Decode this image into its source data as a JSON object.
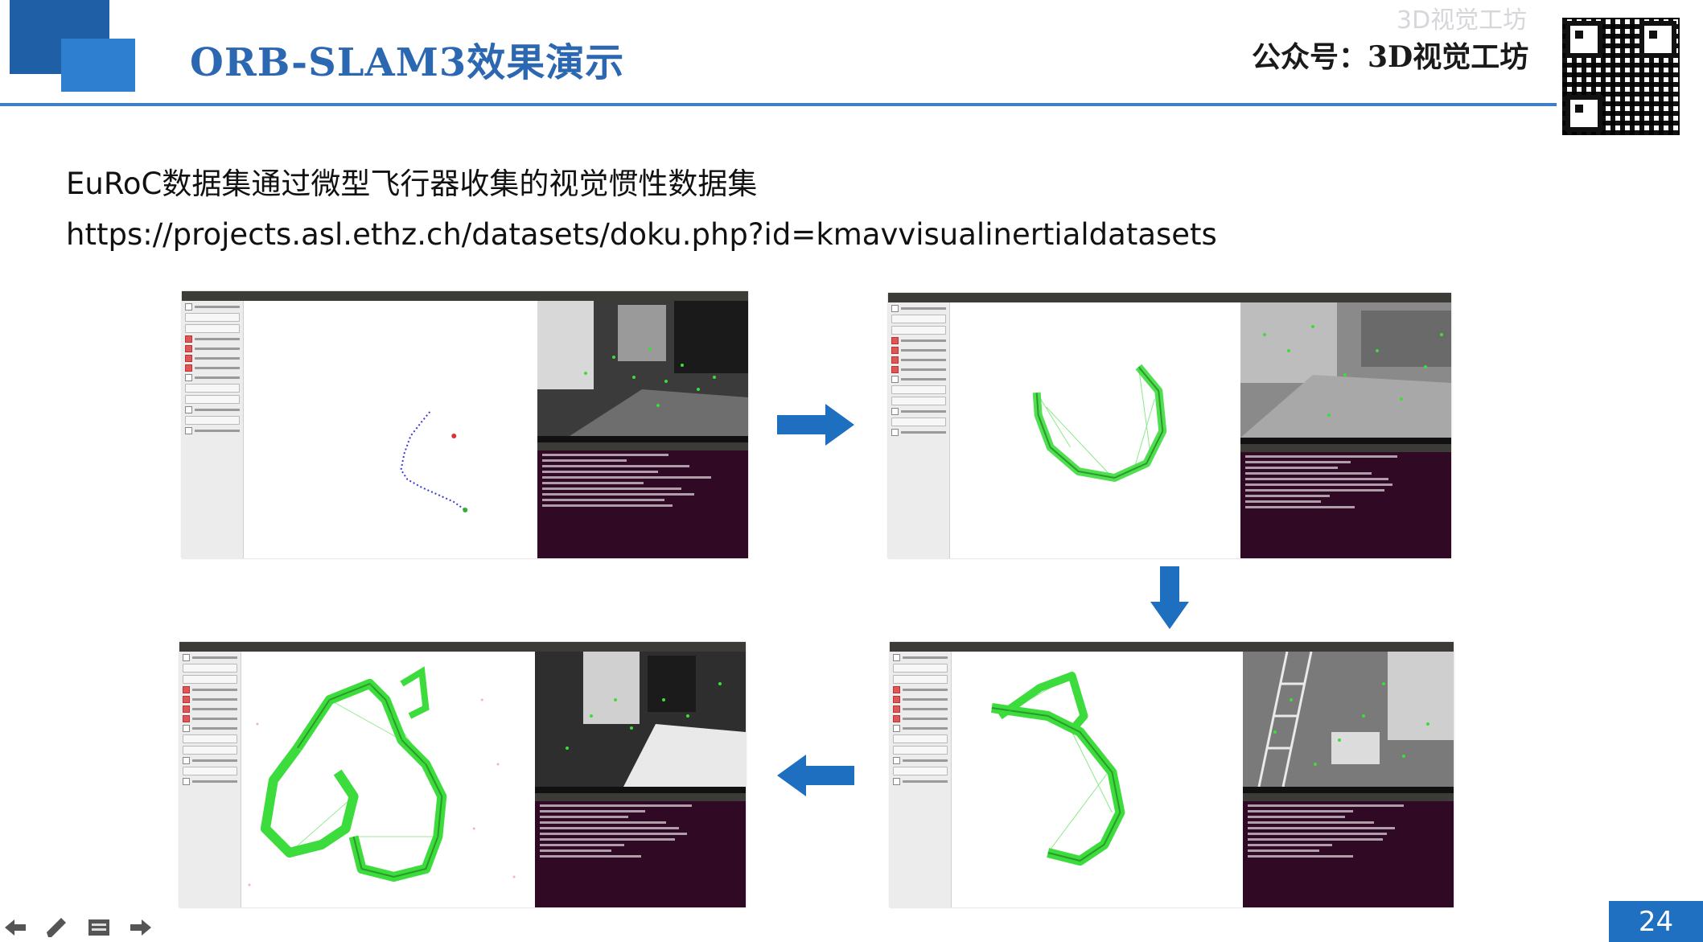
{
  "header": {
    "title": "ORB-SLAM3效果演示",
    "account_label": "公众号：3D视觉工坊",
    "watermark": "3D视觉工坊"
  },
  "content": {
    "line1": "EuRoC数据集通过微型飞行器收集的视觉惯性数据集",
    "line2": "https://projects.asl.ethz.ch/datasets/doku.php?id=kmavvisualinertialdatasets"
  },
  "screenshots": [
    {
      "name": "step-1",
      "panel_items": [
        "Follow Camera",
        "Camera View",
        "Top View",
        "Show Points",
        "Show KeyFrames",
        "Show Graph",
        "Show Inertial Graph",
        "Localization Mode",
        "Reset",
        "Stop",
        "Step By Step",
        "Show LBA opt"
      ]
    },
    {
      "name": "step-2"
    },
    {
      "name": "step-3"
    },
    {
      "name": "step-4"
    }
  ],
  "footer": {
    "page_number": "24",
    "tools": [
      "back-icon",
      "pen-icon",
      "slides-icon",
      "forward-icon"
    ]
  },
  "colors": {
    "brand_blue": "#2c68b2",
    "arrow_blue": "#1f6fc0",
    "terminal_bg": "#300a24",
    "trajectory_green": "#3ddc3d"
  }
}
